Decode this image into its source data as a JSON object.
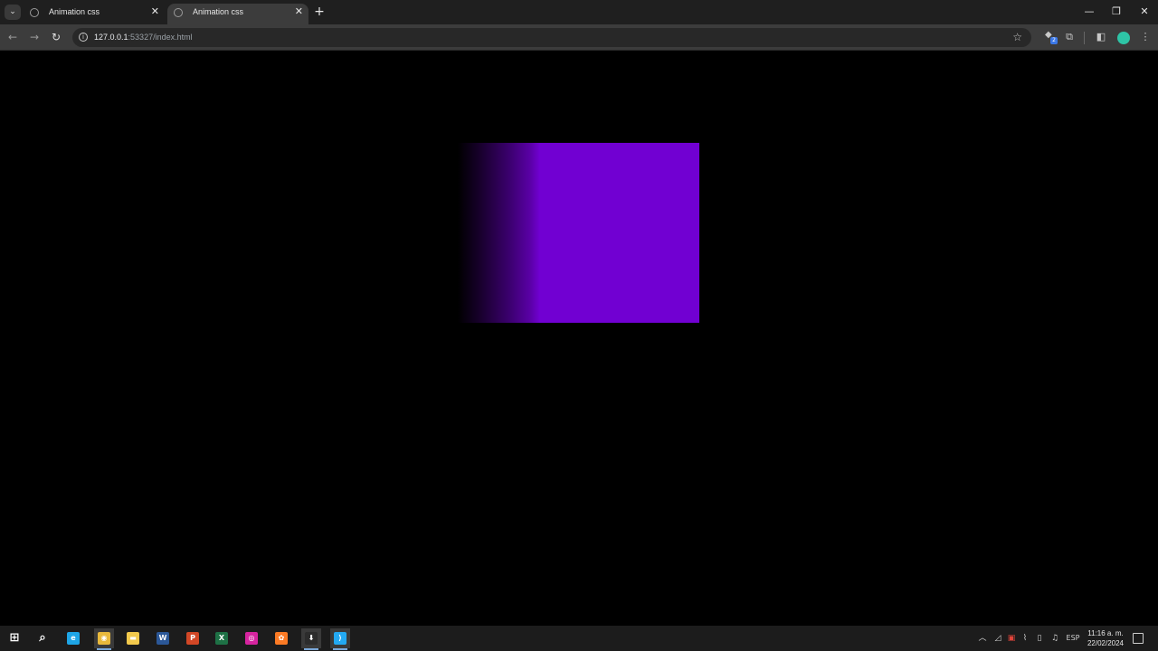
{
  "browser": {
    "tabs": [
      {
        "title": "Animation css",
        "active": false
      },
      {
        "title": "Animation css",
        "active": true
      }
    ],
    "address": {
      "host": "127.0.0.1",
      "rest": ":53327/index.html"
    },
    "extension_badge_count": "2",
    "icons": {
      "tab_list": "chevron-down-icon",
      "tab_favicon": "globe-icon",
      "new_tab": "plus-icon",
      "back": "arrow-left-icon",
      "forward": "arrow-right-icon",
      "reload": "reload-icon",
      "site_info": "info-icon",
      "bookmark": "star-icon",
      "extensions": "puzzle-icon",
      "side_panel": "side-panel-icon",
      "menu": "kebab-menu-icon"
    }
  },
  "page": {
    "background": "#000000",
    "box_color": "#7100d2"
  },
  "taskbar": {
    "apps": [
      {
        "name": "start",
        "glyph": "⊞",
        "color": "#ffffff"
      },
      {
        "name": "search",
        "glyph": "⌕",
        "color": "#ffffff"
      },
      {
        "name": "edge",
        "glyph": "e",
        "color": "#1ea5e6"
      },
      {
        "name": "chrome",
        "glyph": "◉",
        "color": "#e8b93c"
      },
      {
        "name": "file-explorer",
        "glyph": "▬",
        "color": "#f2c94c"
      },
      {
        "name": "word",
        "glyph": "W",
        "color": "#2b5797"
      },
      {
        "name": "powerpoint",
        "glyph": "P",
        "color": "#d24726"
      },
      {
        "name": "excel",
        "glyph": "X",
        "color": "#1e7145"
      },
      {
        "name": "instagram",
        "glyph": "◎",
        "color": "#d6249f"
      },
      {
        "name": "xampp",
        "glyph": "✿",
        "color": "#fb7a24"
      },
      {
        "name": "app-download",
        "glyph": "⬇",
        "color": "#2c2c2c"
      },
      {
        "name": "vscode",
        "glyph": "⟩",
        "color": "#23a9f2"
      }
    ],
    "language": "ESP",
    "time": "11:16 a. m.",
    "date": "22/02/2024"
  }
}
